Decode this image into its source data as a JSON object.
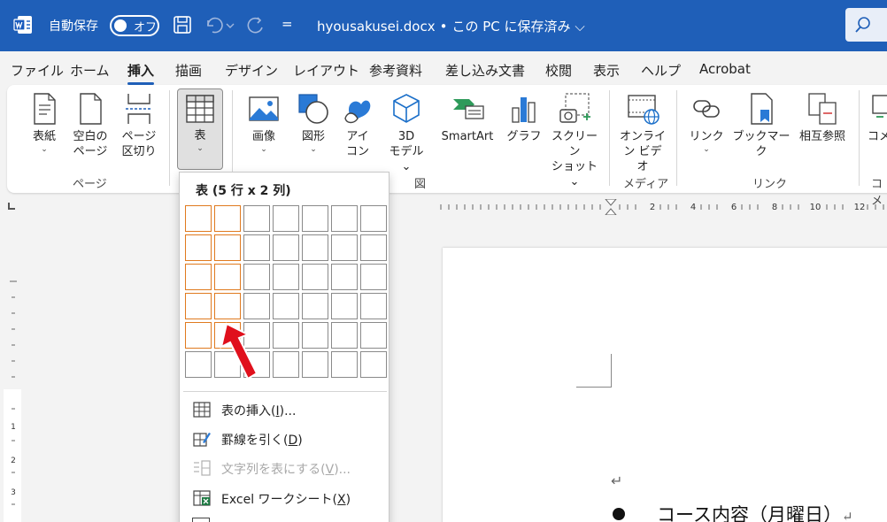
{
  "titlebar": {
    "autosave_label": "自動保存",
    "toggle_state": "オフ",
    "qat_more": "=",
    "doc_name": "hyousakusei.docx",
    "doc_separator": "•",
    "save_status": "この PC に保存済み",
    "save_status_chevron": "⌵"
  },
  "menu": {
    "tabs": [
      "ファイル",
      "ホーム",
      "挿入",
      "描画",
      "デザイン",
      "レイアウト",
      "参考資料",
      "差し込み文書",
      "校閲",
      "表示",
      "ヘルプ",
      "Acrobat"
    ],
    "active_tab": "挿入"
  },
  "ribbon": {
    "cover": {
      "line1": "表紙",
      "chev": "⌄"
    },
    "blank_page": {
      "line1": "空白の",
      "line2": "ページ"
    },
    "page_break": {
      "line1": "ページ",
      "line2": "区切り"
    },
    "table": {
      "line1": "表",
      "chev": "⌄"
    },
    "pictures": {
      "line1": "画像",
      "chev": "⌄"
    },
    "shapes": {
      "line1": "図形",
      "chev": "⌄"
    },
    "icons": {
      "line1": "アイ",
      "line2": "コン"
    },
    "models3d": {
      "line1": "3D",
      "line2": "モデル ⌄"
    },
    "smartart": {
      "line1": "SmartArt"
    },
    "chart": {
      "line1": "グラフ"
    },
    "screenshot": {
      "line1": "スクリーン",
      "line2": "ショット ⌄"
    },
    "online_video": {
      "line1": "オンライ",
      "line2": "ン ビデオ"
    },
    "link": {
      "line1": "リンク",
      "chev": "⌄"
    },
    "bookmark": {
      "line1": "ブックマーク"
    },
    "cross_ref": {
      "line1": "相互参照"
    },
    "comment_partial": {
      "line1": "コメ"
    },
    "groups": {
      "pages": "ページ",
      "illustrations": "図",
      "media": "メディア",
      "links": "リンク",
      "comments_partial": "コメ"
    }
  },
  "ruler": {
    "numbers": [
      "2",
      "4",
      "6",
      "8",
      "10",
      "12"
    ]
  },
  "document": {
    "para_mark": "↵",
    "line_text": "コース内容（月曜日）",
    "line_return": "↵"
  },
  "table_dropdown": {
    "title": "表 (5 行 x 2 列)",
    "grid": {
      "rows": 6,
      "cols": 7,
      "selected_rows": 5,
      "selected_cols": 2
    },
    "items": [
      {
        "label": "表の挿入",
        "key": "I",
        "suffix": "...",
        "disabled": false
      },
      {
        "label": "罫線を引く",
        "key": "D",
        "suffix": "",
        "disabled": false
      },
      {
        "label": "文字列を表にする",
        "key": "V",
        "suffix": "...",
        "disabled": true
      },
      {
        "label": "Excel ワークシート",
        "key": "X",
        "suffix": "",
        "disabled": false
      }
    ]
  },
  "colors": {
    "titlebar": "#1f5fb8",
    "grid_highlight": "#e07a1f",
    "pointer_arrow": "#e0101c"
  }
}
